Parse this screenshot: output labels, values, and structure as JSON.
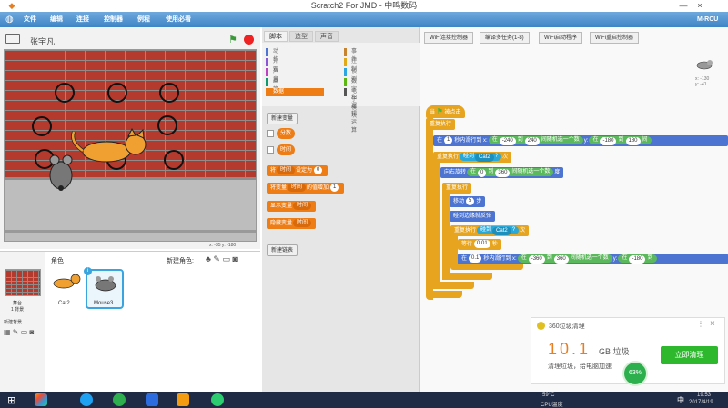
{
  "window": {
    "title": "Scratch2 For JMD - 中鸣数码",
    "brand": "M-RCU",
    "minimize": "—",
    "close": "×"
  },
  "menu": {
    "items": [
      "文件",
      "编辑",
      "连接",
      "控制器",
      "例程",
      "使用必看"
    ]
  },
  "stage": {
    "sprite_name": "张宇凡",
    "coords": "x: -35   y: -180"
  },
  "sprites": {
    "header": "角色",
    "new_label": "新建角色:",
    "stage_label": "舞台",
    "stage_backdrops": "1 背景",
    "new_backdrop_label": "新建背景",
    "items": [
      {
        "name": "Cat2"
      },
      {
        "name": "Mouse3",
        "badge": "i"
      }
    ]
  },
  "palette": {
    "tabs": [
      "脚本",
      "造型",
      "声音"
    ],
    "categories_left": [
      "动作",
      "外观",
      "声音",
      "画笔",
      "数据"
    ],
    "categories_right": [
      "事件",
      "控制",
      "侦测",
      "数字和逻辑运算",
      "电子模块"
    ],
    "category_colors_left": [
      "#4c74d0",
      "#8a55d7",
      "#bb42c3",
      "#0e9a6c",
      "#ee7d16"
    ],
    "category_colors_right": [
      "#c88330",
      "#e1a91a",
      "#2ca5e2",
      "#5cb712",
      "#555555"
    ],
    "selected": "数据",
    "new_var_button": "新建变量",
    "var1": "分数",
    "var2": "时间",
    "set_block": {
      "pre": "将",
      "var": "时间",
      "mid": "设定为",
      "val": "0"
    },
    "change_block": {
      "pre": "将变量",
      "var": "时间",
      "mid": "的值增加",
      "val": "1"
    },
    "show_block": {
      "pre": "显示变量",
      "var": "时间"
    },
    "hide_block": {
      "pre": "隐藏变量",
      "var": "时间"
    },
    "new_list_button": "新建链表"
  },
  "toolbar": {
    "buttons": [
      "WiFi连接控制器",
      "编译多任务(1-8)",
      "WiFi启动程序",
      "WiFi重启控制器"
    ]
  },
  "script_area": {
    "sprite_coords": "x: -130\ny: -41",
    "hat": {
      "pre": "当",
      "post": "被点击"
    },
    "forever1": "重复执行",
    "glide1": {
      "pre": "在",
      "secs": "1",
      "t1": "秒内滑行到 x:",
      "p1": "在",
      "a": "-240",
      "to1": "到",
      "b": "240",
      "r1": "间随机选一个数",
      "y": "y:",
      "p2": "在",
      "c": "-180",
      "to2": "到",
      "d": "180",
      "r2": "间"
    },
    "repeat_until1": {
      "pre": "重复执行",
      "cond": "碰到",
      "target": "Cat2",
      "q": "?",
      "post": "次"
    },
    "turn": {
      "pre": "向右旋转",
      "p": "在",
      "a": "0",
      "to": "到",
      "b": "360",
      "r": "间随机选一个数",
      "post": "度"
    },
    "forever2": "重复执行",
    "move": {
      "pre": "移动",
      "val": "5",
      "post": "步"
    },
    "bounce": "碰到边缘就反弹",
    "repeat_until2": {
      "pre": "重复执行",
      "cond": "碰到",
      "target": "Cat2",
      "q": "?",
      "post": "次"
    },
    "wait": {
      "pre": "等待",
      "val": "0.01",
      "post": "秒"
    },
    "glide2": {
      "pre": "在",
      "secs": "0.1",
      "t1": "秒内滑行到 x:",
      "p1": "在",
      "a": "-360",
      "to1": "到",
      "b": "360",
      "r1": "间随机选一个数",
      "y": "y:",
      "p2": "在",
      "c": "-180",
      "to2": "到"
    }
  },
  "popup": {
    "app": "360垃圾清理",
    "amount": "10.1",
    "unit": "GB 垃圾",
    "desc": "清理垃圾，给电脑加速",
    "button": "立即清理",
    "gauge": "63%",
    "close": "×",
    "menu": "⋮"
  },
  "taskbar": {
    "temp": "59°C",
    "temp_label": "CPU温度",
    "time": "19:53",
    "date": "2017/4/19",
    "lang": "中"
  }
}
